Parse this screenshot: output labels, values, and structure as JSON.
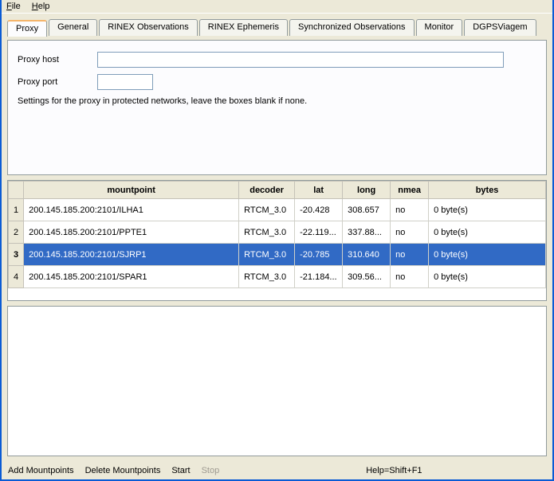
{
  "menu": {
    "file": "File",
    "help": "Help"
  },
  "tabs": [
    "Proxy",
    "General",
    "RINEX Observations",
    "RINEX Ephemeris",
    "Synchronized Observations",
    "Monitor",
    "DGPSViagem"
  ],
  "activeTab": 0,
  "proxy": {
    "hostLabel": "Proxy host",
    "portLabel": "Proxy port",
    "hostValue": "",
    "portValue": "",
    "note": "Settings for the proxy in protected networks, leave the boxes blank if none."
  },
  "table": {
    "headers": [
      "mountpoint",
      "decoder",
      "lat",
      "long",
      "nmea",
      "bytes"
    ],
    "rows": [
      {
        "n": "1",
        "mount": "200.145.185.200:2101/ILHA1",
        "dec": "RTCM_3.0",
        "lat": "-20.428",
        "long": "308.657",
        "nmea": "no",
        "bytes": "0 byte(s)"
      },
      {
        "n": "2",
        "mount": "200.145.185.200:2101/PPTE1",
        "dec": "RTCM_3.0",
        "lat": "-22.119...",
        "long": "337.88...",
        "nmea": "no",
        "bytes": "0 byte(s)"
      },
      {
        "n": "3",
        "mount": "200.145.185.200:2101/SJRP1",
        "dec": "RTCM_3.0",
        "lat": "-20.785",
        "long": "310.640",
        "nmea": "no",
        "bytes": "0 byte(s)"
      },
      {
        "n": "4",
        "mount": "200.145.185.200:2101/SPAR1",
        "dec": "RTCM_3.0",
        "lat": "-21.184...",
        "long": "309.56...",
        "nmea": "no",
        "bytes": "0 byte(s)"
      }
    ],
    "selected": 2
  },
  "actions": {
    "add": "Add Mountpoints",
    "del": "Delete Mountpoints",
    "start": "Start",
    "stop": "Stop"
  },
  "helpHint": "Help=Shift+F1"
}
